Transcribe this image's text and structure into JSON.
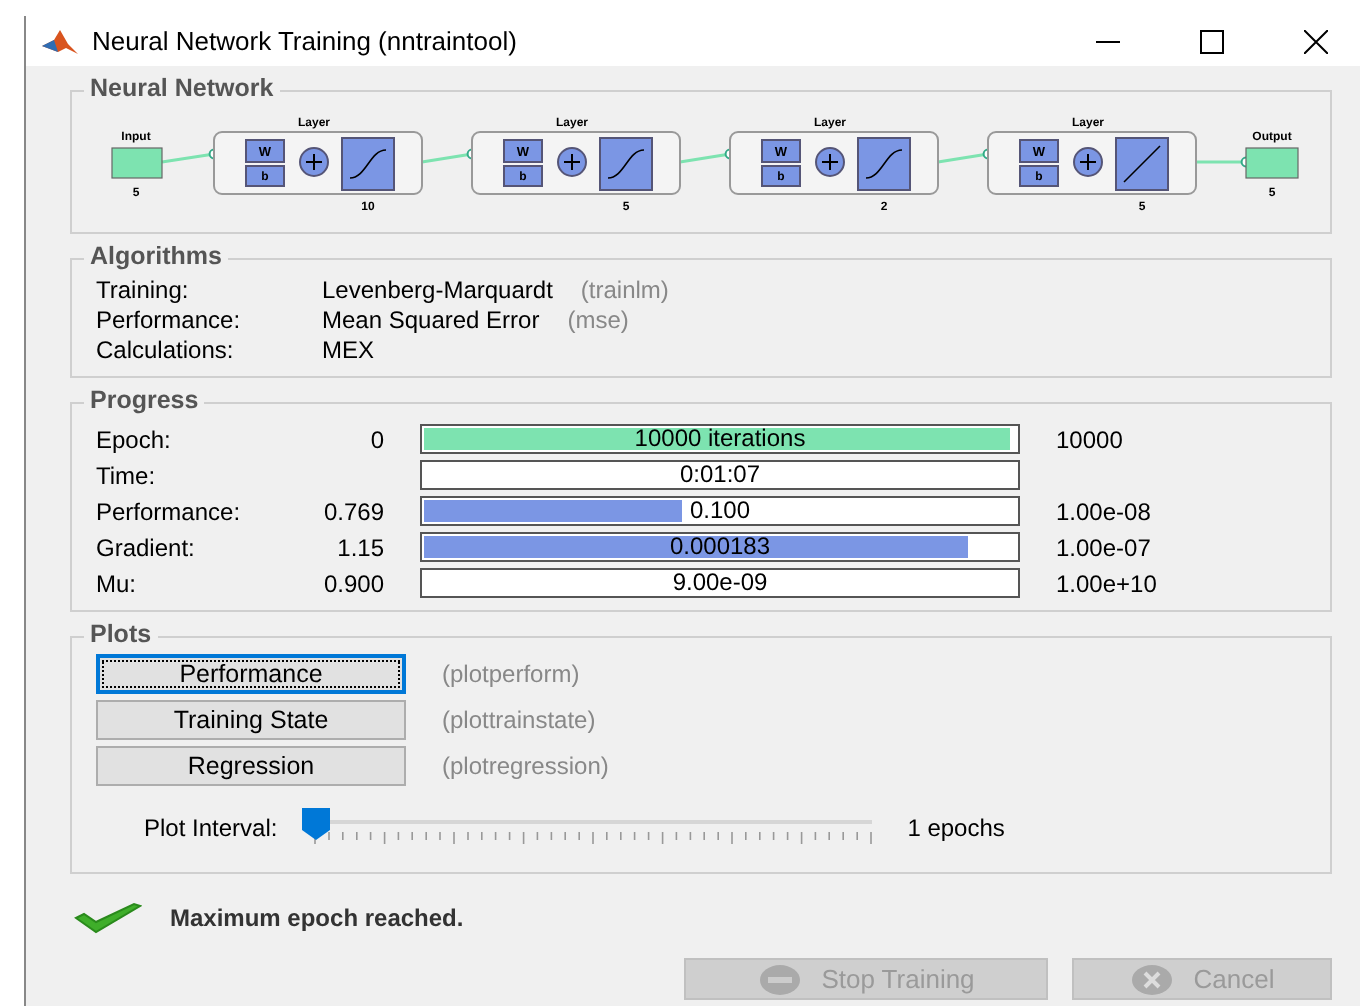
{
  "window": {
    "title": "Neural Network Training (nntraintool)"
  },
  "network": {
    "title": "Neural Network",
    "input": {
      "label": "Input",
      "size": "5"
    },
    "layers": [
      {
        "label": "Layer",
        "weight": "W",
        "bias": "b",
        "size": "10",
        "kind": "sigmoid"
      },
      {
        "label": "Layer",
        "weight": "W",
        "bias": "b",
        "size": "5",
        "kind": "sigmoid"
      },
      {
        "label": "Layer",
        "weight": "W",
        "bias": "b",
        "size": "2",
        "kind": "sigmoid"
      },
      {
        "label": "Layer",
        "weight": "W",
        "bias": "b",
        "size": "5",
        "kind": "linear"
      }
    ],
    "output": {
      "label": "Output",
      "size": "5"
    }
  },
  "algorithms": {
    "title": "Algorithms",
    "rows": [
      {
        "label": "Training:",
        "value": "Levenberg-Marquardt",
        "function": "(trainlm)"
      },
      {
        "label": "Performance:",
        "value": "Mean Squared Error",
        "function": "(mse)"
      },
      {
        "label": "Calculations:",
        "value": "MEX"
      }
    ]
  },
  "progress": {
    "title": "Progress",
    "rows": [
      {
        "label": "Epoch:",
        "start": "0",
        "reading": "10000 iterations",
        "level": 0.99,
        "color": "#7de3b0",
        "end": "10000"
      },
      {
        "label": "Time:",
        "reading": "0:01:07",
        "level": 0
      },
      {
        "label": "Performance:",
        "start": "0.769",
        "reading": "0.100",
        "level": 0.44,
        "color": "#7b96e4",
        "end": "1.00e-08"
      },
      {
        "label": "Gradient:",
        "start": "1.15",
        "reading": "0.000183",
        "level": 0.92,
        "color": "#7b96e4",
        "end": "1.00e-07"
      },
      {
        "label": "Mu:",
        "start": "0.900",
        "reading": "9.00e-09",
        "level": 0,
        "end": "1.00e+10"
      }
    ]
  },
  "plots": {
    "title": "Plots",
    "buttons": [
      {
        "label": "Performance",
        "function": "(plotperform)",
        "focused": true
      },
      {
        "label": "Training State",
        "function": "(plottrainstate)",
        "focused": false
      },
      {
        "label": "Regression",
        "function": "(plotregression)",
        "focused": false
      }
    ],
    "interval": {
      "label": "Plot Interval:",
      "level": 0,
      "reading": "1 epochs"
    }
  },
  "status": {
    "kind": "success",
    "message": "Maximum epoch reached."
  },
  "buttons": [
    {
      "label": "Stop Training",
      "kind": "stop",
      "disabled": true
    },
    {
      "label": "Cancel",
      "kind": "cancel",
      "disabled": true
    }
  ]
}
